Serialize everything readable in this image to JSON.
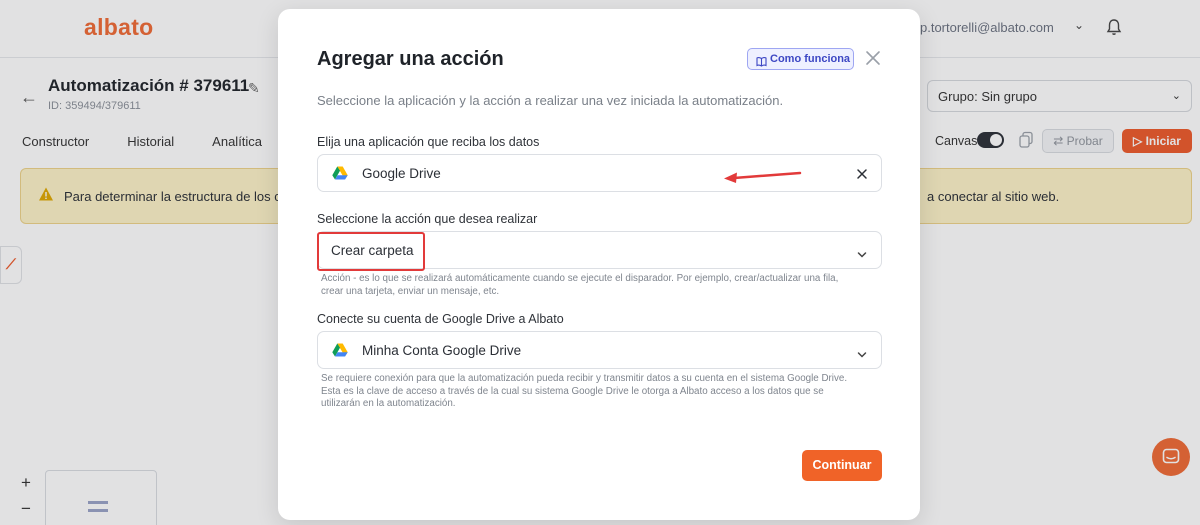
{
  "app": {
    "logo": "albato",
    "user_email": "p.tortorelli@albato.com"
  },
  "automation": {
    "title": "Automatización # 379611",
    "id_label": "ID: 359494/379611",
    "group_select": "Grupo: Sin grupo"
  },
  "tabs": [
    {
      "label": "Constructor"
    },
    {
      "label": "Historial"
    },
    {
      "label": "Analítica"
    }
  ],
  "toolbar": {
    "canvas_label": "Canvas",
    "probar_label": "Probar",
    "iniciar_label": "Iniciar"
  },
  "warning": {
    "text_left": "Para determinar la estructura de los c",
    "text_right": "a conectar al sitio web."
  },
  "zoom": {
    "in": "+",
    "out": "−"
  },
  "modal": {
    "title": "Agregar una acción",
    "como_funciona": "Como funciona",
    "subtitle": "Seleccione la aplicación y la acción a realizar una vez iniciada la automatización.",
    "app_field": {
      "label": "Elija una aplicación que reciba los datos",
      "value": "Google Drive"
    },
    "action_field": {
      "label": "Seleccione la acción que desea realizar",
      "value": "Crear carpeta",
      "help_line1": "Acción - es lo que se realizará automáticamente cuando se ejecute el disparador. Por ejemplo, crear/actualizar una fila,",
      "help_line2": "crear una tarjeta, enviar un mensaje, etc."
    },
    "account_field": {
      "label": "Conecte su cuenta de Google Drive a Albato",
      "value": "Minha Conta Google Drive",
      "help_line1": "Se requiere conexión para que la automatización pueda recibir y transmitir datos a su cuenta en el sistema Google Drive.",
      "help_line2": "Esta es la clave de acceso a través de la cual su sistema Google Drive le otorga a Albato acceso a los datos que se",
      "help_line3": "utilizarán en la automatización."
    },
    "continue_label": "Continuar"
  },
  "colors": {
    "brand_orange": "#f06a35",
    "highlight_red": "#e23a3a",
    "como_bg": "#eef0ff",
    "warning_bg": "#fdf3c7"
  },
  "icons": [
    "back-arrow-icon",
    "pencil-icon",
    "bell-icon",
    "copy-icon",
    "warning-icon",
    "book-icon",
    "close-icon",
    "google-drive-icon",
    "chevron-down-icon",
    "chat-icon",
    "red-arrow-annotation"
  ]
}
